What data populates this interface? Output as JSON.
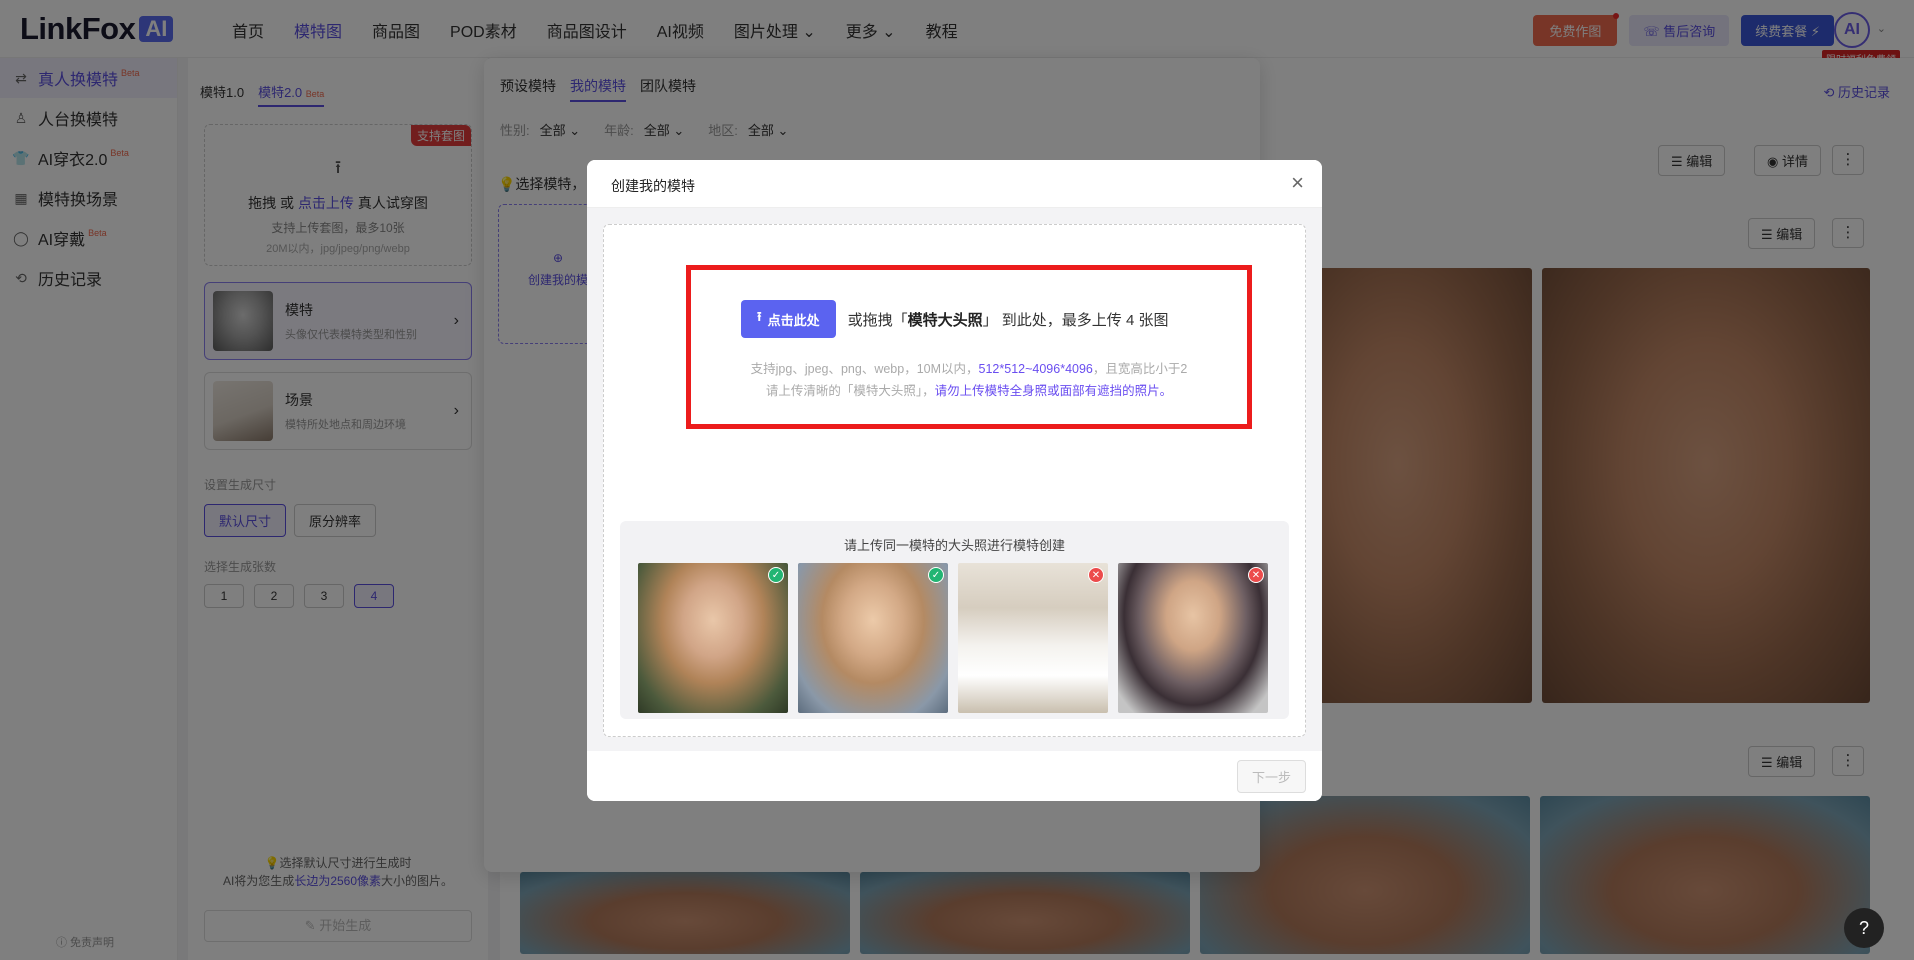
{
  "nav": {
    "logo_text": "LinkFox",
    "logo_ai": "AI",
    "links": [
      "首页",
      "模特图",
      "商品图",
      "POD素材",
      "商品图设计",
      "AI视频",
      "图片处理 ⌄",
      "更多 ⌄",
      "教程"
    ],
    "active_link": "模特图",
    "free_btn": "免费作图",
    "after_sales": "售后咨询",
    "renew": "续费套餐 ⚡",
    "avatar": "AI",
    "avatar_tag": "限时福利免费领"
  },
  "sidebar": {
    "items": [
      {
        "label": "真人换模特",
        "beta": "Beta",
        "icon": "person-swap-icon"
      },
      {
        "label": "人台换模特",
        "beta": "",
        "icon": "mannequin-icon"
      },
      {
        "label": "AI穿衣2.0",
        "beta": "Beta",
        "icon": "shirt-icon"
      },
      {
        "label": "模特换场景",
        "beta": "",
        "icon": "scene-icon"
      },
      {
        "label": "AI穿戴",
        "beta": "Beta",
        "icon": "accessory-icon"
      },
      {
        "label": "历史记录",
        "beta": "",
        "icon": "history-icon"
      }
    ],
    "footer": "ⓘ 免责声明"
  },
  "config": {
    "tab1": "模特1.0",
    "tab2": "模特2.0",
    "tab2_beta": "Beta",
    "upload_tag": "支持套图",
    "upload_prefix": "拖拽 或 ",
    "upload_link": "点击上传",
    "upload_suffix": " 真人试穿图",
    "upload_sub": "支持上传套图，最多10张",
    "upload_formats": "20M以内，jpg/jpeg/png/webp",
    "card_model_title": "模特",
    "card_model_sub": "头像仅代表模特类型和性别",
    "card_scene_title": "场景",
    "card_scene_sub": "模特所处地点和周边环境",
    "size_label": "设置生成尺寸",
    "size_default": "默认尺寸",
    "size_original": "原分辨率",
    "count_label": "选择生成张数",
    "counts": [
      "1",
      "2",
      "3",
      "4"
    ],
    "note_l1": "💡选择默认尺寸进行生成时",
    "note_l2_pre": "AI将为您生成",
    "note_l2_hl": "长边为2560像素",
    "note_l2_post": "大小的图片。",
    "gen_btn": "开始生成"
  },
  "picker": {
    "tabs": [
      "预设模特",
      "我的模特",
      "团队模特"
    ],
    "active_tab": "我的模特",
    "filters": [
      {
        "label": "性别:",
        "value": "全部 ⌄"
      },
      {
        "label": "年龄:",
        "value": "全部 ⌄"
      },
      {
        "label": "地区:",
        "value": "全部 ⌄"
      }
    ],
    "tip": "💡选择模特，",
    "create": "创建我的模"
  },
  "results": {
    "history": "⟲ 历史记录",
    "edit": "编辑",
    "detail": "详情",
    "more": "⋮",
    "help": "?"
  },
  "modal": {
    "title": "创建我的模特",
    "close": "×",
    "upload_btn": "点击此处",
    "drag_pre": "或拖拽「",
    "drag_bold": "模特大头照",
    "drag_post": "」 到此处，最多上传 4 张图",
    "hint1_pre": "支持jpg、jpeg、png、webp，10M以内，",
    "hint1_hl": "512*512~4096*4096",
    "hint1_post": "，且宽高比小于2",
    "hint2_pre": "请上传清晰的「模特大头照」，",
    "hint2_hl": "请勿上传模特全身照或面部有遮挡的照片。",
    "examples_title": "请上传同一模特的大头照进行模特创建",
    "examples": [
      {
        "status": "ok",
        "mark": "✓"
      },
      {
        "status": "ok",
        "mark": "✓"
      },
      {
        "status": "no",
        "mark": "✕"
      },
      {
        "status": "no",
        "mark": "✕"
      }
    ],
    "next": "下一步"
  },
  "colors": {
    "accent": "#5b4fe0",
    "highlight_red": "#ec1c1c",
    "upload_btn": "#5b63f0"
  }
}
